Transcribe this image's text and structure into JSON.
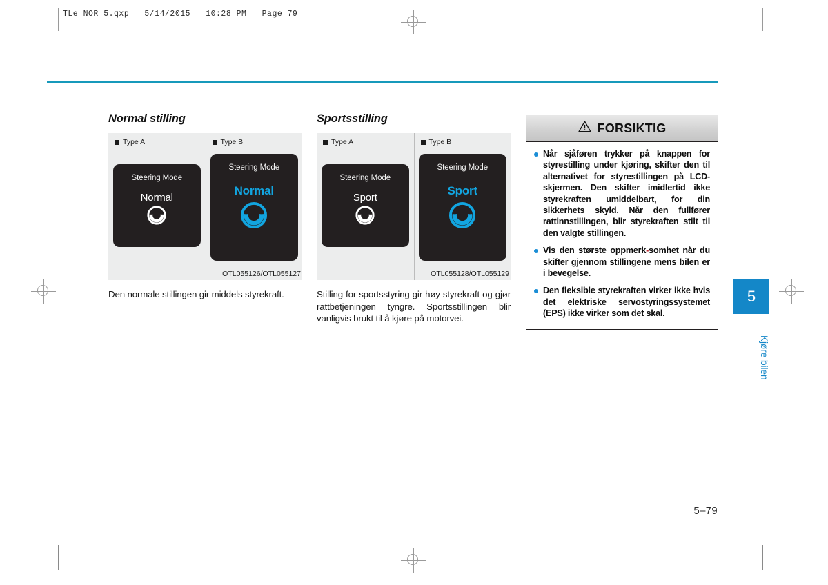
{
  "printer": {
    "header_line": "TLe NOR 5.qxp   5/14/2015   10:28 PM   Page 79",
    "page_number": "5–79"
  },
  "columns": [
    {
      "title": "Normal stilling",
      "figure": {
        "type_a_label": "Type A",
        "type_b_label": "Type B",
        "lcd_title": "Steering Mode",
        "mode_a": "Normal",
        "mode_b": "Normal",
        "code": "OTL055126/OTL055127"
      },
      "paragraph": "Den normale stillingen gir middels styrekraft."
    },
    {
      "title": "Sportsstilling",
      "figure": {
        "type_a_label": "Type A",
        "type_b_label": "Type B",
        "lcd_title": "Steering Mode",
        "mode_a": "Sport",
        "mode_b": "Sport",
        "code": "OTL055128/OTL055129"
      },
      "paragraph": "Stilling for sportsstyring gir høy styrekraft og gjør rattbetjeningen tyngre. Sportsstillingen blir vanligvis brukt til å kjøre på motorvei."
    }
  ],
  "caution": {
    "title": "FORSIKTIG",
    "items": [
      "Når sjåføren trykker på knappen for styrestilling under kjøring, skifter den til alternativet for styrestillingen på LCD-skjermen. Den skifter imidlertid ikke styrekraften umiddelbart, for din sikkerhets skyld. Når den fullfører rattinnstillingen, blir styrekraften stilt til den valgte stillingen.",
      "Vis den største oppmerksomhet når du skifter gjennom stillingene mens bilen er i bevegelse.",
      "Den fleksible styrekraften virker ikke hvis det elektriske servostyringssystemet (EPS) ikke virker som det skal."
    ]
  },
  "side_tab": {
    "number": "5",
    "label": "Kjøre bilen"
  },
  "colors": {
    "accent_rule": "#1799bb",
    "tab_blue": "#1487c8",
    "lcd_cyan": "#12a5e0",
    "bullet_blue": "#1b8ed6"
  }
}
